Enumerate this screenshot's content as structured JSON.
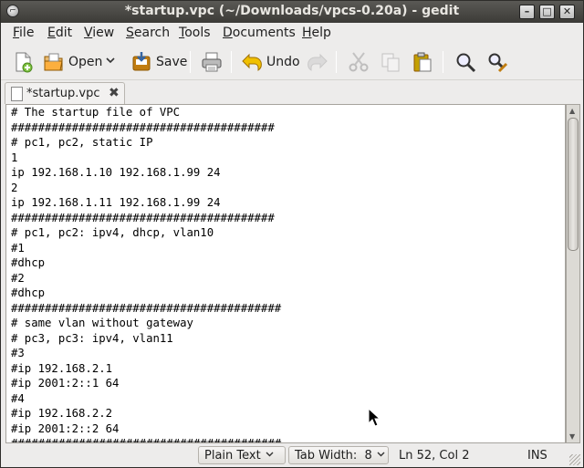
{
  "window": {
    "title": "*startup.vpc (~/Downloads/vpcs-0.20a) - gedit",
    "minimize_glyph": "–",
    "maximize_glyph": "□",
    "close_glyph": "✕"
  },
  "menu": {
    "file": {
      "u": "F",
      "rest": "ile"
    },
    "edit": {
      "u": "E",
      "rest": "dit"
    },
    "view": {
      "u": "V",
      "rest": "iew"
    },
    "search": {
      "u": "S",
      "rest": "earch"
    },
    "tools": {
      "u": "T",
      "rest": "ools"
    },
    "documents": {
      "u": "D",
      "rest": "ocuments"
    },
    "help": {
      "u": "H",
      "rest": "elp"
    }
  },
  "toolbar": {
    "open_label": "Open",
    "save_label": "Save",
    "undo_label": "Undo",
    "icons": [
      "new-document-icon",
      "open-folder-icon",
      "dropdown-icon",
      "save-icon",
      "print-icon",
      "undo-icon",
      "redo-icon",
      "cut-icon",
      "copy-icon",
      "paste-icon",
      "search-icon",
      "replace-icon"
    ]
  },
  "tab": {
    "label": "*startup.vpc",
    "close_glyph": "✖"
  },
  "editor": {
    "text": "# The startup file of VPC\n#######################################\n# pc1, pc2, static IP\n1\nip 192.168.1.10 192.168.1.99 24\n2\nip 192.168.1.11 192.168.1.99 24\n#######################################\n# pc1, pc2: ipv4, dhcp, vlan10\n#1\n#dhcp\n#2\n#dhcp\n########################################\n# same vlan without gateway\n# pc3, pc3: ipv4, vlan11\n#3\n#ip 192.168.2.1\n#ip 2001:2::1 64\n#4\n#ip 192.168.2.2\n#ip 2001:2::2 64\n########################################"
  },
  "statusbar": {
    "language": "Plain Text",
    "tab_width": "Tab Width:  8",
    "position": "Ln 52, Col 2",
    "mode": "INS"
  },
  "colors": {
    "titlebar": "#3c3b37",
    "window_bg": "#edeceb",
    "editor_bg": "#ffffff"
  }
}
